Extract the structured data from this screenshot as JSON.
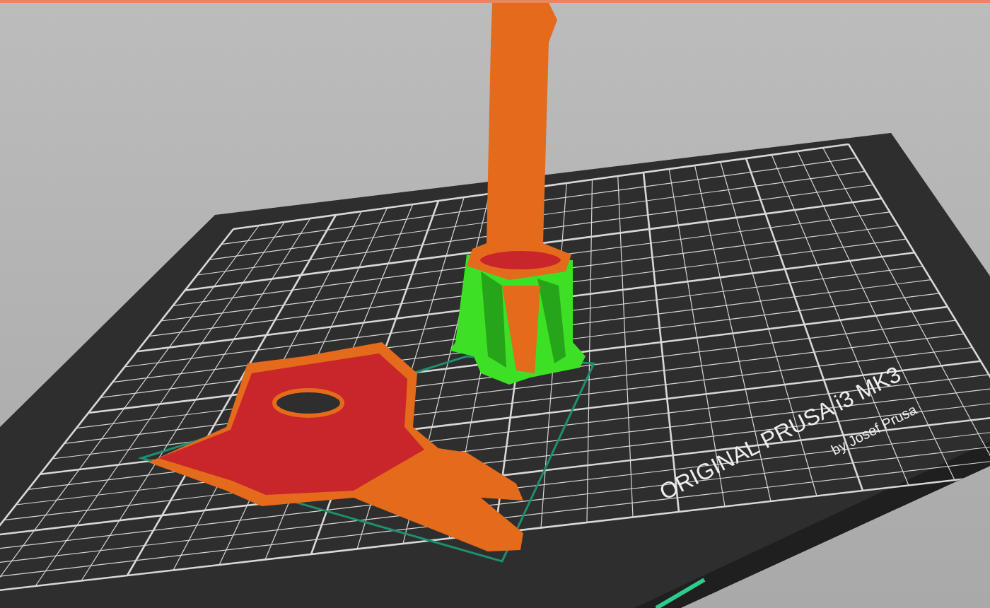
{
  "bed": {
    "brand": "ORIGINAL PRUSA i3 MK3",
    "maker": "by Josef Prusa"
  }
}
